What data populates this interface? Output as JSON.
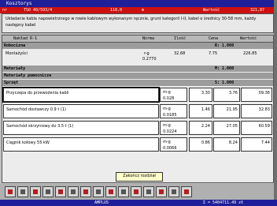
{
  "window": {
    "title": "Kosztorys"
  },
  "infobar": {
    "left": "nr",
    "code": "TSO 40/593/4",
    "value": "118,0",
    "unit": "m",
    "right_label": "Wartość",
    "right_value": "321,87"
  },
  "description": "Układanie kabla napowietrznego w rowie kablowym wykonanym ręcznie, grunt kategorii I-II, kabel o średnicy 30-58 mm, każdy następny kabel",
  "table_header": {
    "name": "Nakład R-1",
    "unit": "Norma",
    "qty": "Ilość",
    "price": "Cena",
    "value": "Wartość"
  },
  "sections": [
    {
      "label": "Robocizna",
      "right": "R: 1.000"
    },
    {
      "label": "Materiały",
      "right": "M: 1.000"
    },
    {
      "label": "Materiały pomocnicze",
      "right": ""
    },
    {
      "label": "Sprzęt",
      "right": "S: 1.000"
    }
  ],
  "rows": {
    "robocizna": [
      {
        "name": "Montażyści",
        "unit": "r-g",
        "norm": "0.2770",
        "qty": "32.68",
        "price": "7.75",
        "value": "226.85"
      }
    ],
    "sprzet": [
      {
        "name": "Przyczepa do przewożenia kabli",
        "unit": "m-g",
        "norm": "0.028",
        "qty": "3.30",
        "price": "3.76",
        "value": "09.36"
      },
      {
        "name": "Samochód dostawczy 0.9 t (1)",
        "unit": "m-g",
        "norm": "0.0185",
        "qty": "1.46",
        "price": "21.95",
        "value": "32.83"
      },
      {
        "name": "Samochód skrzyniowy do 3.5 t (1)",
        "unit": "m-g",
        "norm": "0.0224",
        "qty": "2.24",
        "price": "27.05",
        "value": "60.59"
      },
      {
        "name": "Ciągnik kołowy 55 kW",
        "unit": "m-g",
        "norm": "0.0066",
        "qty": "0.86",
        "price": "8.24",
        "value": "7.44"
      }
    ]
  },
  "tooltip": "Zakończ rozdział",
  "status": {
    "left": "AMPLUS",
    "right": "Σ = 5404711.49 zł"
  },
  "toolbar_icons": [
    "back-icon",
    "tool2-icon",
    "tool3-icon",
    "tool4-icon",
    "tool5-icon",
    "tool6-icon",
    "tool7-icon",
    "tool8-icon",
    "tool9-icon",
    "tool10-icon",
    "tool11-icon",
    "tool12-icon",
    "tool13-icon",
    "tool14-icon",
    "exit-icon"
  ],
  "colors": {
    "title": "#1f1f9a",
    "infobar": "#cc1010",
    "section": "#9c9c9c"
  }
}
